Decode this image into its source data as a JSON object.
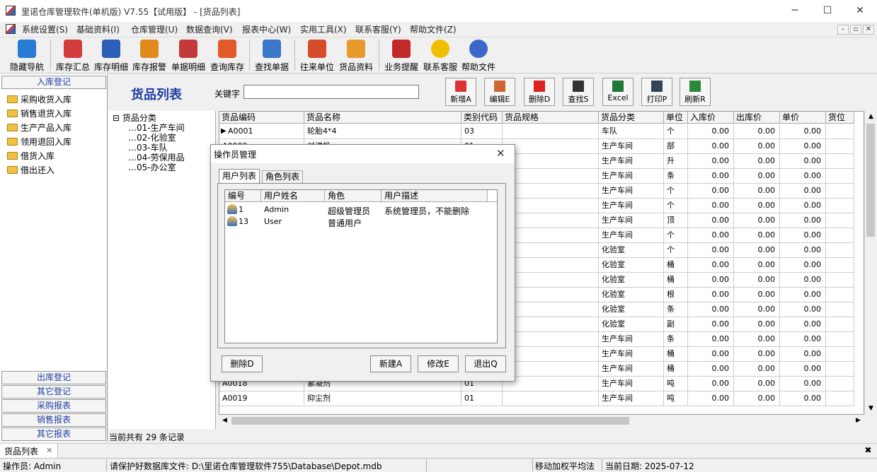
{
  "window": {
    "title": "里诺仓库管理软件(单机版) V7.55【试用版】 - [货品列表]",
    "min": "─",
    "max": "☐",
    "close": "✕"
  },
  "menu": [
    "系统设置(S)",
    "基础资料(I)",
    "仓库管理(U)",
    "数据查询(V)",
    "报表中心(W)",
    "实用工具(X)",
    "联系客服(Y)",
    "帮助文件(Z)"
  ],
  "mdi_controls": [
    "–",
    "▫",
    "✕"
  ],
  "toolbar": [
    {
      "label": "隐藏导航",
      "icon": "monitor-icon",
      "color": "#2a7bd4"
    },
    {
      "label": "库存汇总",
      "icon": "inventory-summary-icon",
      "color": "#d23c3c"
    },
    {
      "label": "库存明细",
      "icon": "inventory-detail-icon",
      "color": "#2b5fb8"
    },
    {
      "label": "库存报警",
      "icon": "alarm-icon",
      "color": "#e08a1e"
    },
    {
      "label": "单据明细",
      "icon": "documents-icon",
      "color": "#c33a3a"
    },
    {
      "label": "查询库存",
      "icon": "query-inventory-icon",
      "color": "#e05a2a"
    },
    {
      "label": "查找单据",
      "icon": "find-document-icon",
      "color": "#3b77c8"
    },
    {
      "label": "往来单位",
      "icon": "partners-icon",
      "color": "#d64b2a"
    },
    {
      "label": "货品资料",
      "icon": "goods-icon",
      "color": "#e89a2c"
    },
    {
      "label": "业务提醒",
      "icon": "calendar-icon",
      "color": "#c22a2a"
    },
    {
      "label": "联系客服",
      "icon": "support-icon",
      "color": "#f0c000"
    },
    {
      "label": "帮助文件",
      "icon": "help-icon",
      "color": "#3a68c8"
    }
  ],
  "nav": {
    "top_header": "入库登记",
    "items": [
      "采购收货入库",
      "销售退货入库",
      "生产产品入库",
      "领用退回入库",
      "借货入库",
      "借出还入"
    ],
    "bottom_headers": [
      "出库登记",
      "其它登记",
      "采购报表",
      "销售报表",
      "其它报表"
    ]
  },
  "page": {
    "title": "货品列表",
    "keyword_label": "关键字",
    "keyword_value": ""
  },
  "actions": [
    {
      "label": "新增A",
      "icon": "add-icon",
      "color": "#d33"
    },
    {
      "label": "编辑E",
      "icon": "edit-icon",
      "color": "#c63"
    },
    {
      "label": "删除D",
      "icon": "delete-icon",
      "color": "#d22"
    },
    {
      "label": "查找S",
      "icon": "binoculars-icon",
      "color": "#333"
    },
    {
      "label": "Excel",
      "icon": "excel-icon",
      "color": "#1d7a3a"
    },
    {
      "label": "打印P",
      "icon": "print-icon",
      "color": "#345"
    },
    {
      "label": "刷新R",
      "icon": "refresh-icon",
      "color": "#2a8a3a"
    }
  ],
  "tree": {
    "root": "货品分类",
    "children": [
      "01-生产车间",
      "02-化验室",
      "03-车队",
      "04-劳保用品",
      "05-办公室"
    ]
  },
  "grid": {
    "columns": [
      "货品编码",
      "货品名称",
      "类别代码",
      "货品规格",
      "货品分类",
      "单位",
      "入库价",
      "出库价",
      "单价",
      "货位"
    ],
    "rows": [
      [
        "A0001",
        "轮胎4*4",
        "03",
        "",
        "车队",
        "个",
        "0.00",
        "0.00",
        "0.00",
        ""
      ],
      [
        "A0002",
        "对讲机",
        "01",
        "",
        "生产车间",
        "部",
        "0.00",
        "0.00",
        "0.00",
        ""
      ],
      [
        "",
        "",
        "",
        "",
        "生产车间",
        "升",
        "0.00",
        "0.00",
        "0.00",
        ""
      ],
      [
        "",
        "",
        "",
        "",
        "生产车间",
        "条",
        "0.00",
        "0.00",
        "0.00",
        ""
      ],
      [
        "",
        "",
        "",
        "",
        "生产车间",
        "个",
        "0.00",
        "0.00",
        "0.00",
        ""
      ],
      [
        "",
        "",
        "",
        "",
        "生产车间",
        "个",
        "0.00",
        "0.00",
        "0.00",
        ""
      ],
      [
        "",
        "",
        "",
        "",
        "生产车间",
        "顶",
        "0.00",
        "0.00",
        "0.00",
        ""
      ],
      [
        "",
        "",
        "",
        "",
        "生产车间",
        "个",
        "0.00",
        "0.00",
        "0.00",
        ""
      ],
      [
        "",
        "",
        "",
        "",
        "化验室",
        "个",
        "0.00",
        "0.00",
        "0.00",
        ""
      ],
      [
        "",
        "",
        "",
        "",
        "化验室",
        "桶",
        "0.00",
        "0.00",
        "0.00",
        ""
      ],
      [
        "",
        "",
        "",
        "",
        "化验室",
        "桶",
        "0.00",
        "0.00",
        "0.00",
        ""
      ],
      [
        "",
        "",
        "",
        "",
        "化验室",
        "根",
        "0.00",
        "0.00",
        "0.00",
        ""
      ],
      [
        "",
        "",
        "",
        "",
        "化验室",
        "条",
        "0.00",
        "0.00",
        "0.00",
        ""
      ],
      [
        "",
        "",
        "",
        "",
        "化验室",
        "副",
        "0.00",
        "0.00",
        "0.00",
        ""
      ],
      [
        "",
        "",
        "",
        "",
        "生产车间",
        "条",
        "0.00",
        "0.00",
        "0.00",
        ""
      ],
      [
        "",
        "",
        "",
        "",
        "生产车间",
        "桶",
        "0.00",
        "0.00",
        "0.00",
        ""
      ],
      [
        "",
        "",
        "",
        "",
        "生产车间",
        "桶",
        "0.00",
        "0.00",
        "0.00",
        ""
      ],
      [
        "A0018",
        "絮凝剂",
        "01",
        "",
        "生产车间",
        "吨",
        "0.00",
        "0.00",
        "0.00",
        ""
      ],
      [
        "A0019",
        "抑尘剂",
        "01",
        "",
        "生产车间",
        "吨",
        "0.00",
        "0.00",
        "0.00",
        ""
      ]
    ]
  },
  "record_count": "当前共有 29 条记录",
  "doc_tab": {
    "label": "货品列表",
    "close": "✕"
  },
  "status": {
    "operator": "操作员: Admin",
    "notice": "请保护好数据库文件: D:\\里诺仓库管理软件755\\Database\\Depot.mdb",
    "method": "移动加权平均法",
    "date": "当前日期: 2025-07-12"
  },
  "dialog": {
    "title": "操作员管理",
    "tabs": [
      "用户列表",
      "角色列表"
    ],
    "columns": [
      "编号",
      "用户姓名",
      "角色",
      "用户描述"
    ],
    "users": [
      {
        "id": "1",
        "name": "Admin",
        "role": "超级管理员",
        "desc": "系统管理员，不能删除"
      },
      {
        "id": "13",
        "name": "User",
        "role": "普通用户",
        "desc": ""
      }
    ],
    "buttons": {
      "delete": "删除D",
      "new": "新建A",
      "modify": "修改E",
      "exit": "退出Q"
    }
  }
}
